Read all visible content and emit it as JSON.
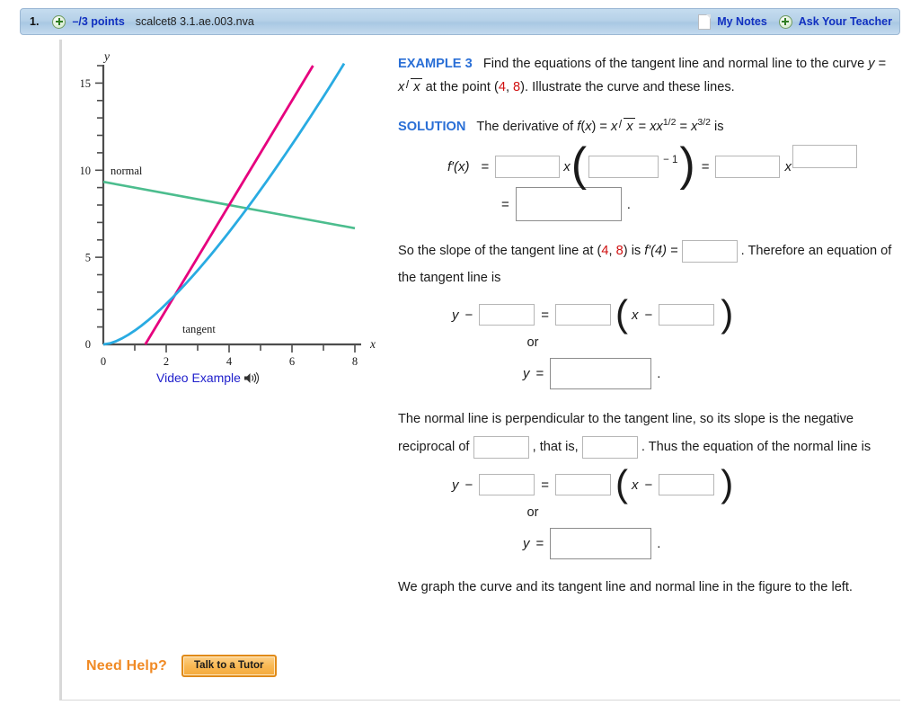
{
  "header": {
    "question_number": "1.",
    "points": "–/3 points",
    "question_id": "scalcet8 3.1.ae.003.nva",
    "my_notes_label": "My Notes",
    "ask_teacher_label": "Ask Your Teacher",
    "plus_icon": "plus-circle-icon",
    "notes_icon": "note-page-icon",
    "bar_color": "#b6d1e8",
    "link_color": "#1030c0"
  },
  "figure": {
    "video_example_label": "Video Example",
    "speaker_icon": "speaker-icon",
    "curve_label_tangent": "tangent",
    "curve_label_normal": "normal"
  },
  "chart_data": {
    "type": "line",
    "title": "",
    "xlabel": "x",
    "ylabel": "y",
    "xlim": [
      0,
      8
    ],
    "ylim": [
      0,
      16
    ],
    "xticks": [
      0,
      1,
      2,
      3,
      4,
      5,
      6,
      7,
      8
    ],
    "xtick_labels": [
      "0",
      "",
      "2",
      "",
      "4",
      "",
      "6",
      "",
      "8"
    ],
    "yticks": [
      0,
      1,
      2,
      3,
      4,
      5,
      6,
      7,
      8,
      9,
      10,
      11,
      12,
      13,
      14,
      15,
      16
    ],
    "ytick_labels": [
      "0",
      "",
      "",
      "",
      "",
      "5",
      "",
      "",
      "",
      "",
      "10",
      "",
      "",
      "",
      "",
      "15",
      ""
    ],
    "grid": false,
    "legend_position": "inline-annotations",
    "annotations": [
      {
        "text": "normal",
        "x": 0.35,
        "y": 10.2
      },
      {
        "text": "tangent",
        "x": 2.3,
        "y": 1.15
      }
    ],
    "series": [
      {
        "name": "curve y = x*sqrt(x)",
        "color": "#29abe2",
        "equation": "y = x^(3/2)",
        "points": [
          [
            0,
            0
          ],
          [
            0.5,
            0.354
          ],
          [
            1,
            1
          ],
          [
            1.5,
            1.837
          ],
          [
            2,
            2.828
          ],
          [
            2.5,
            3.953
          ],
          [
            3,
            5.196
          ],
          [
            3.5,
            6.548
          ],
          [
            4,
            8
          ],
          [
            4.5,
            9.546
          ],
          [
            5,
            11.18
          ],
          [
            5.5,
            12.9
          ],
          [
            6,
            14.7
          ],
          [
            6.3,
            15.81
          ]
        ]
      },
      {
        "name": "tangent line at (4, 8)",
        "color": "#e6007e",
        "equation": "y = 3x - 4",
        "points": [
          [
            1.333,
            0
          ],
          [
            6.67,
            16
          ]
        ]
      },
      {
        "name": "normal line at (4, 8)",
        "color": "#4cbd8e",
        "equation": "y = -x/3 + 28/3",
        "points": [
          [
            0,
            9.333
          ],
          [
            8,
            6.667
          ]
        ]
      }
    ],
    "point_of_interest": {
      "x": 4,
      "y": 8
    }
  },
  "problem": {
    "example_label": "EXAMPLE 3",
    "statement_a": "Find the equations of the tangent line and normal line to the curve",
    "statement_b": "at the point",
    "point_x": "4",
    "point_y": "8",
    "statement_c": "Illustrate the curve and these lines.",
    "solution_label": "SOLUTION",
    "solution_intro": "The derivative of",
    "solution_intro_tail": "is",
    "fprime_label": "f′(x)",
    "exp_minus_one": "− 1",
    "slope_sentence_1": "So the slope of the tangent line at",
    "slope_sentence_mid": "is",
    "fprime4_label": "f′(4) =",
    "slope_sentence_2": ". Therefore",
    "slope_sentence_3": "an equation of the tangent line is",
    "or_word": "or",
    "normal_sentence_1": "The normal line is perpendicular to the tangent line, so its slope is the",
    "normal_sentence_2a": "negative reciprocal of",
    "normal_sentence_2b": ", that is,",
    "normal_sentence_2c": ". Thus the equation of",
    "normal_sentence_3": "the normal line is",
    "closing_1": "We graph the curve and its tangent line and normal line in the figure to",
    "closing_2": "the left."
  },
  "footer": {
    "need_help_label": "Need Help?",
    "tutor_button_label": "Talk to a Tutor",
    "need_help_color": "#f08a24"
  }
}
